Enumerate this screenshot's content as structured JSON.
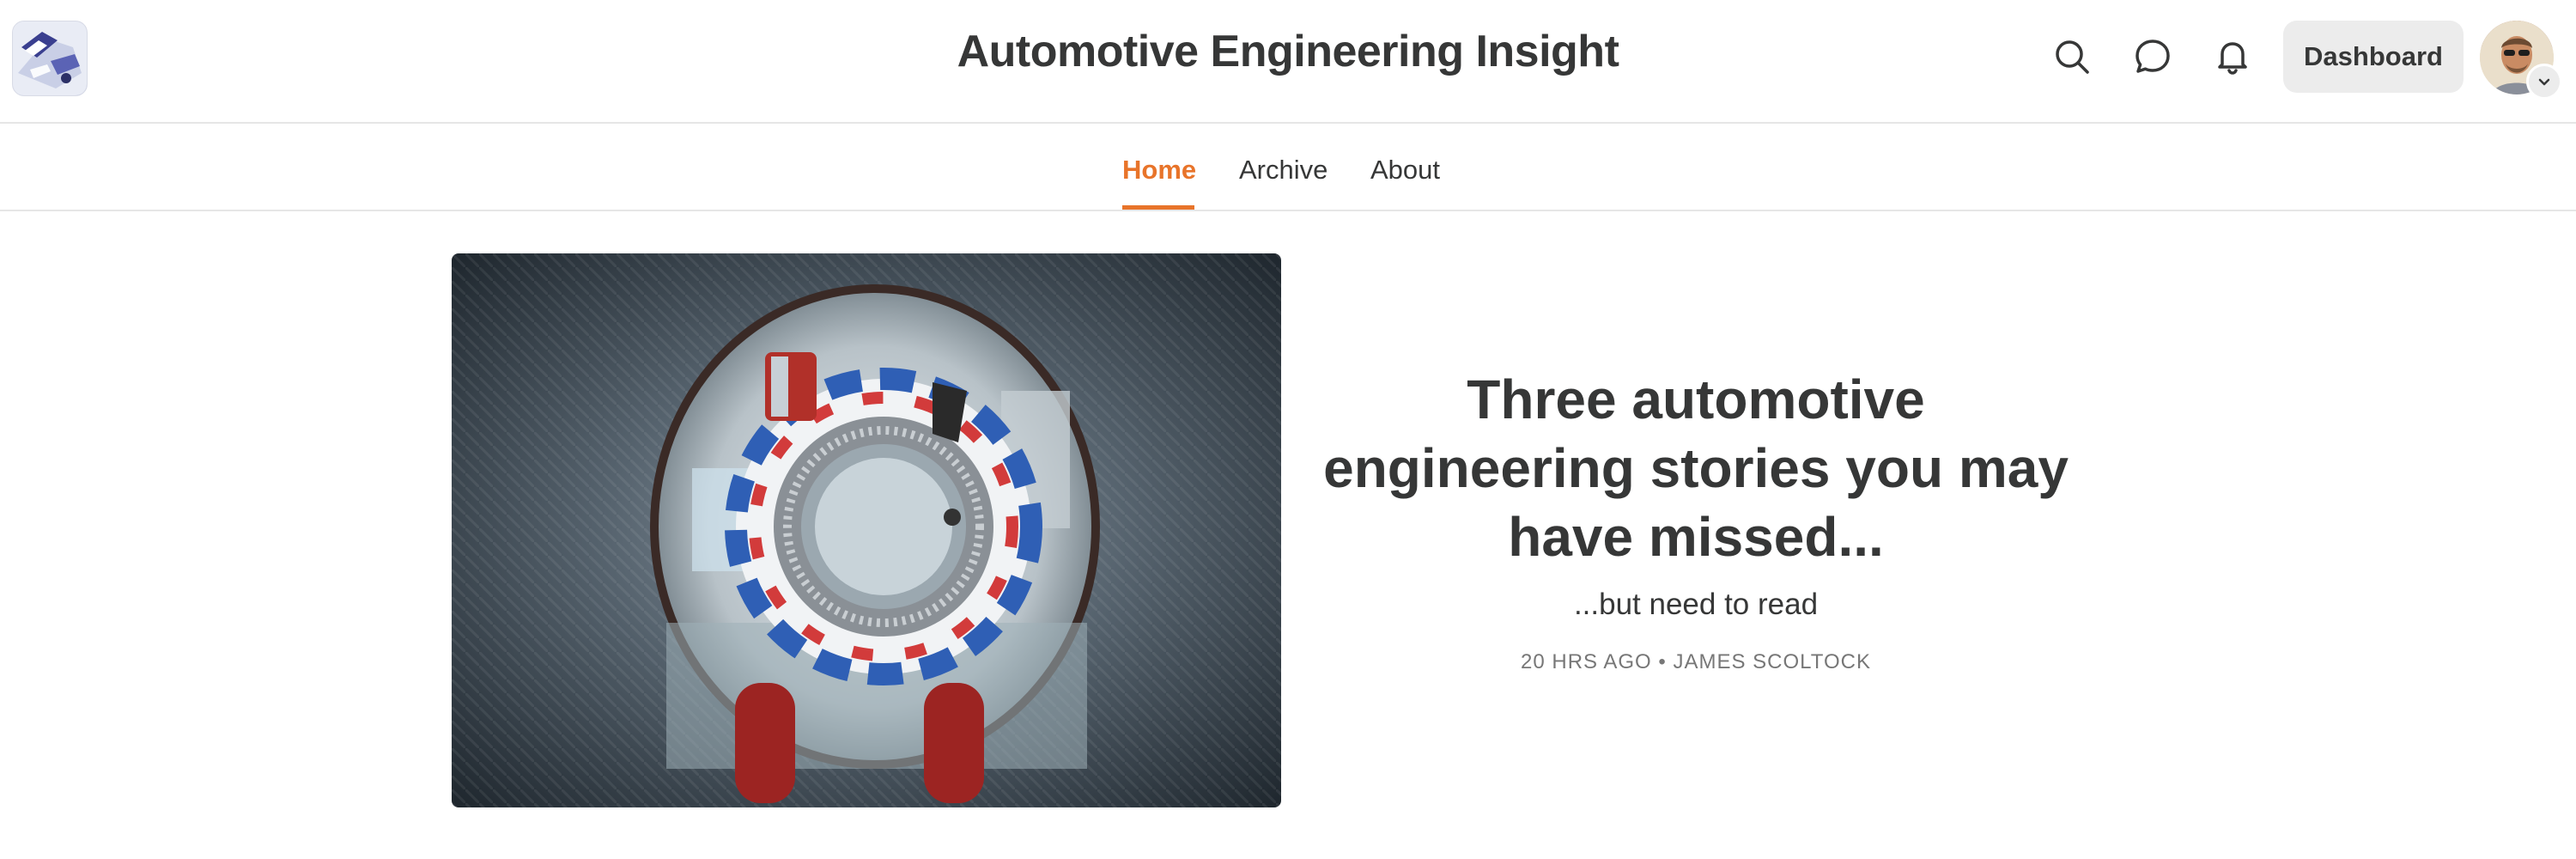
{
  "header": {
    "site_title": "Automotive Engineering Insight",
    "logo_icon": "publication-logo-icon",
    "icons": [
      "search-icon",
      "chat-bubble-icon",
      "bell-icon"
    ],
    "dashboard_label": "Dashboard",
    "avatar_icon": "user-avatar",
    "avatar_menu_icon": "chevron-down-icon"
  },
  "nav": {
    "items": [
      {
        "label": "Home",
        "active": true
      },
      {
        "label": "Archive",
        "active": false
      },
      {
        "label": "About",
        "active": false
      }
    ]
  },
  "featured_post": {
    "image_icon": "electric-motor-stator-photo",
    "title": "Three automotive engineering stories you may have missed...",
    "subtitle": "...but need to read",
    "time_ago": "20 HRS AGO",
    "separator": "•",
    "author": "JAMES SCOLTOCK"
  },
  "colors": {
    "accent": "#e8742a",
    "text": "#363737",
    "meta_text": "#777777",
    "button_bg": "#ececec",
    "divider": "#e6e6e6"
  }
}
